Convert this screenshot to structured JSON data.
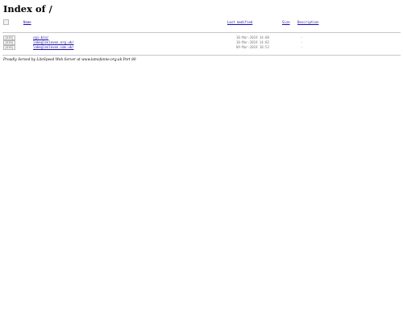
{
  "page": {
    "title": "Index of /"
  },
  "table": {
    "headers": {
      "name": "Name",
      "last_modified": "Last modified",
      "size": "Size",
      "description": "Description"
    },
    "rows": [
      {
        "icon_alt": "[DIR]",
        "name": "cgi-bin/",
        "last_modified": "10-Mar-2019 14:08",
        "size": "-"
      },
      {
        "icon_alt": "[DIR]",
        "name": "lakeglenleven.org.uk/",
        "last_modified": "10-Mar-2019 14:02",
        "size": "-"
      },
      {
        "icon_alt": "[DIR]",
        "name": "lakeglenleven.com.uk/",
        "last_modified": "09-Mar-2019 18:53",
        "size": "-"
      }
    ]
  },
  "footer": {
    "text": "Proudly Served by LiteSpeed Web Server at www.lamofanne.org.uk Port 80"
  },
  "colors": {
    "link": "#1a0dab",
    "rule": "#c8c8c8",
    "muted": "#777777"
  },
  "icons": {
    "header": "blank-icon",
    "row": "folder-icon"
  }
}
